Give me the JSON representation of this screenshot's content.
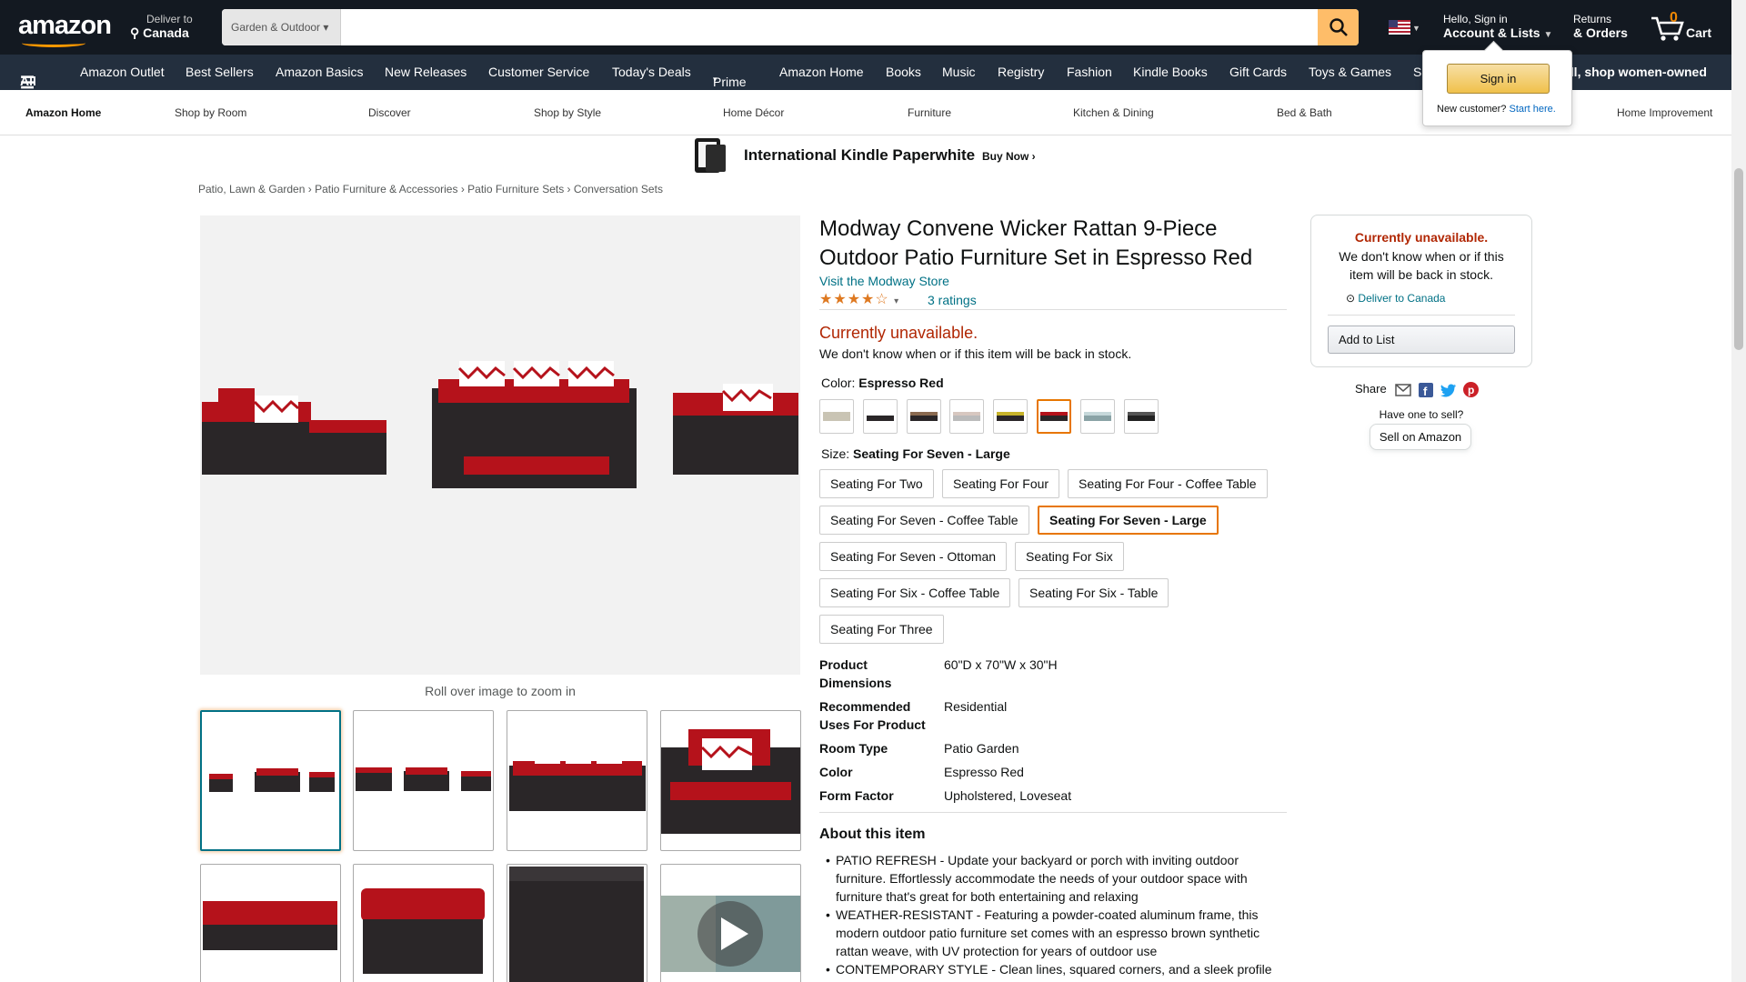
{
  "header": {
    "logo": "amazon",
    "deliver_line1": "Deliver to",
    "deliver_line2": "Canada",
    "search_category": "Garden & Outdoor",
    "search_value": "",
    "account_line1": "Hello, Sign in",
    "account_line2": "Account & Lists",
    "returns_line1": "Returns",
    "returns_line2": "& Orders",
    "cart_count": "0",
    "cart_label": "Cart"
  },
  "nav": {
    "all": "All",
    "items": [
      "Amazon Outlet",
      "Best Sellers",
      "Amazon Basics",
      "New Releases",
      "Customer Service",
      "Today's Deals",
      "Prime",
      "Amazon Home",
      "Books",
      "Music",
      "Registry",
      "Fashion",
      "Kindle Books",
      "Gift Cards",
      "Toys & Games",
      "S"
    ],
    "promo": "all, shop women-owned"
  },
  "subnav": [
    "Amazon Home",
    "Shop by Room",
    "Discover",
    "Shop by Style",
    "Home Décor",
    "Furniture",
    "Kitchen & Dining",
    "Bed & Bath",
    "Home Improvement"
  ],
  "banner": {
    "title": "International Kindle Paperwhite",
    "cta": "Buy Now ›"
  },
  "breadcrumb": [
    "Patio, Lawn & Garden",
    "Patio Furniture & Accessories",
    "Patio Furniture Sets",
    "Conversation Sets"
  ],
  "product": {
    "title": "Modway Convene Wicker Rattan 9-Piece Outdoor Patio Furniture Set in Espresso Red",
    "store_link": "Visit the Modway Store",
    "rating_stars": 4,
    "ratings_count": "3 ratings",
    "availability": "Currently unavailable.",
    "availability_note": "We don't know when or if this item will be back in stock.",
    "color_label": "Color:",
    "color_value": "Espresso Red",
    "size_label": "Size:",
    "size_value": "Seating For Seven - Large",
    "sizes": [
      "Seating For Two",
      "Seating For Four",
      "Seating For Four - Coffee Table",
      "Seating For Seven - Coffee Table",
      "Seating For Seven - Large",
      "Seating For Seven - Ottoman",
      "Seating For Six",
      "Seating For Six - Coffee Table",
      "Seating For Six - Table",
      "Seating For Three"
    ],
    "specs": [
      {
        "k": "Product Dimensions",
        "v": "60\"D x 70\"W x 30\"H"
      },
      {
        "k": "Recommended Uses For Product",
        "v": "Residential"
      },
      {
        "k": "Room Type",
        "v": "Patio Garden"
      },
      {
        "k": "Color",
        "v": "Espresso Red"
      },
      {
        "k": "Form Factor",
        "v": "Upholstered, Loveseat"
      }
    ],
    "about_title": "About this item",
    "bullets": [
      "PATIO REFRESH - Update your backyard or porch with inviting outdoor furniture. Effortlessly accommodate the needs of your outdoor space with furniture that's great for both entertaining and relaxing",
      "WEATHER-RESISTANT - Featuring a powder-coated aluminum frame, this modern outdoor patio furniture set comes with an espresso brown synthetic rattan weave, with UV protection for years of outdoor use",
      "CONTEMPORARY STYLE - Clean lines, squared corners, and a sleek profile"
    ],
    "zoom_hint": "Roll over image to zoom in"
  },
  "buybox": {
    "unavailable": "Currently unavailable.",
    "note": "We don't know when or if this item will be back in stock.",
    "deliver": "Deliver to Canada",
    "add_to_list": "Add to List",
    "share": "Share",
    "have_one": "Have one to sell?",
    "sell": "Sell on Amazon"
  },
  "flyout": {
    "signin": "Sign in",
    "new_customer": "New customer?",
    "start_here": "Start here."
  },
  "colors": {
    "accent": "#e77600",
    "link": "#007185",
    "price_red": "#b12704",
    "nav_dark": "#131921",
    "nav_mid": "#232f3e",
    "fabric_red": "#b5121b",
    "wicker": "#2a2628"
  }
}
